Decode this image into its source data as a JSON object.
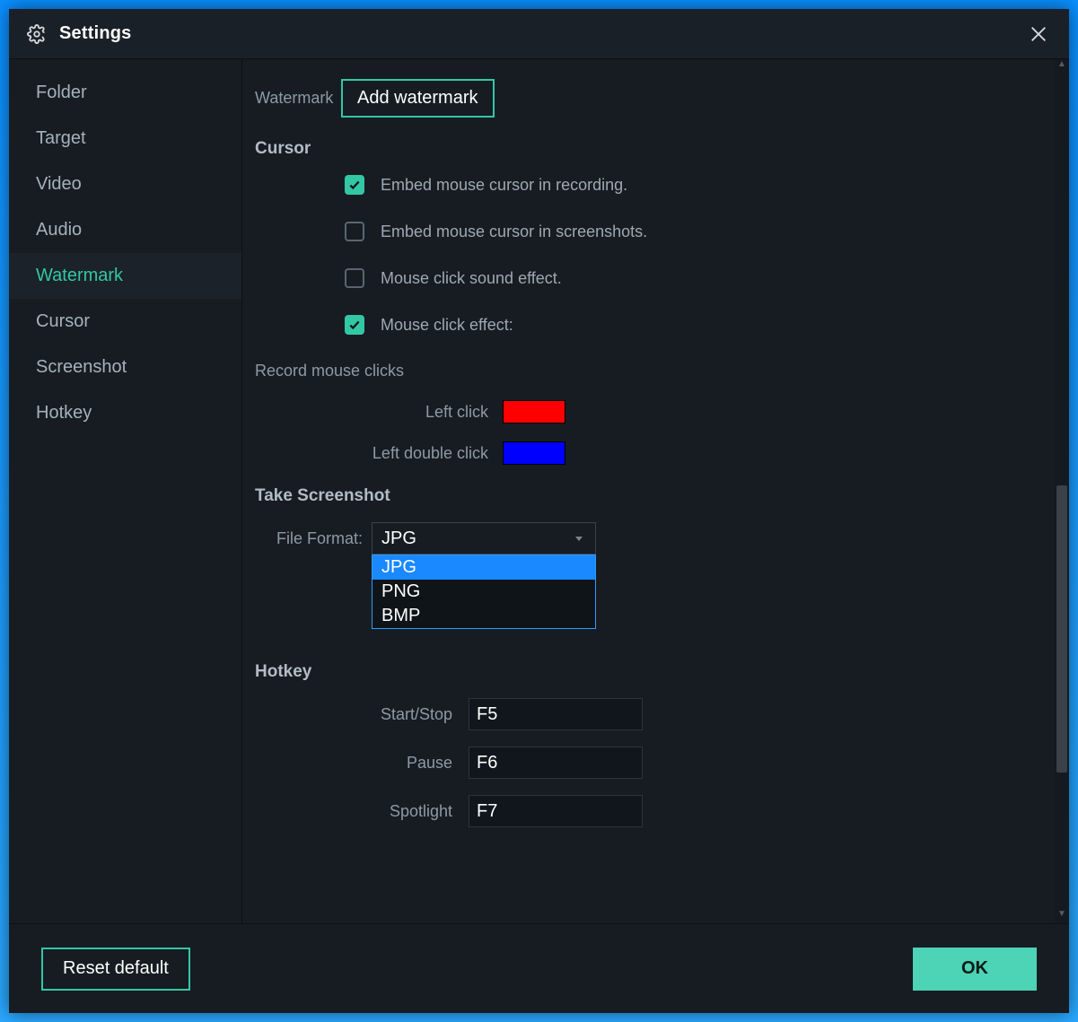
{
  "header": {
    "title": "Settings"
  },
  "sidebar": {
    "items": [
      {
        "label": "Folder"
      },
      {
        "label": "Target"
      },
      {
        "label": "Video"
      },
      {
        "label": "Audio"
      },
      {
        "label": "Watermark"
      },
      {
        "label": "Cursor"
      },
      {
        "label": "Screenshot"
      },
      {
        "label": "Hotkey"
      }
    ],
    "active_index": 4
  },
  "main": {
    "watermark": {
      "label": "Watermark",
      "button": "Add watermark"
    },
    "cursor": {
      "title": "Cursor",
      "opts": [
        {
          "label": "Embed mouse cursor in recording.",
          "checked": true
        },
        {
          "label": "Embed mouse cursor in screenshots.",
          "checked": false
        },
        {
          "label": "Mouse click sound effect.",
          "checked": false
        },
        {
          "label": "Mouse click effect:",
          "checked": true
        }
      ]
    },
    "record_clicks": {
      "title": "Record mouse clicks",
      "left": {
        "label": "Left click",
        "color": "#ff0000"
      },
      "dbl": {
        "label": "Left double click",
        "color": "#0000ff"
      }
    },
    "screenshot": {
      "title": "Take Screenshot",
      "file_format_label": "File Format:",
      "file_format_value": "JPG",
      "options": [
        "JPG",
        "PNG",
        "BMP"
      ],
      "selected_option": "JPG"
    },
    "hotkey": {
      "title": "Hotkey",
      "rows": [
        {
          "label": "Start/Stop",
          "value": "F5"
        },
        {
          "label": "Pause",
          "value": "F6"
        },
        {
          "label": "Spotlight",
          "value": "F7"
        }
      ]
    }
  },
  "footer": {
    "reset": "Reset default",
    "ok": "OK"
  }
}
